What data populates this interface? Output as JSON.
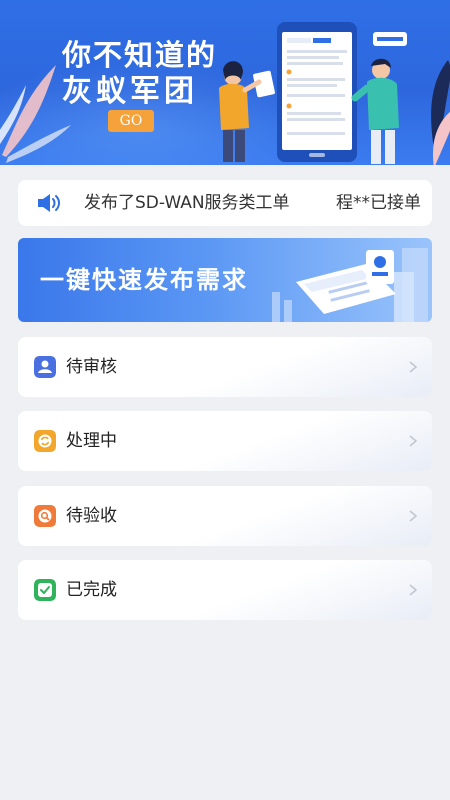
{
  "banner": {
    "title_line1": "你不知道的",
    "title_line2": "灰蚁军团",
    "go_label": "GO"
  },
  "notice": {
    "message": "发布了SD-WAN服务类工单",
    "accepted": "程**已接单"
  },
  "publish": {
    "label": "一键快速发布需求"
  },
  "statuses": [
    {
      "label": "待审核",
      "icon": "person-badge-icon",
      "color": "#4a6fe0"
    },
    {
      "label": "处理中",
      "icon": "refresh-icon",
      "color": "#f2a62b"
    },
    {
      "label": "待验收",
      "icon": "search-icon",
      "color": "#ef7a3a"
    },
    {
      "label": "已完成",
      "icon": "check-icon",
      "color": "#2fb35c"
    }
  ],
  "colors": {
    "banner_blue": "#2f6fe6",
    "go_orange": "#f6a23a",
    "background": "#eef0f4"
  }
}
